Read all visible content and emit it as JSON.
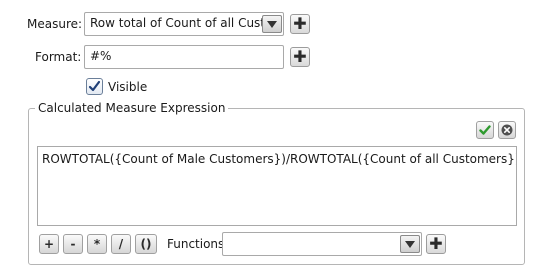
{
  "measure": {
    "label": "Measure:",
    "value": "Row total of Count of all Custo"
  },
  "format": {
    "label": "Format:",
    "value": "#%"
  },
  "visible": {
    "label": "Visible",
    "checked": true
  },
  "expression_group": {
    "title": "Calculated Measure Expression",
    "expression": "ROWTOTAL({Count of Male Customers})/ROWTOTAL({Count of all Customers})"
  },
  "operators": [
    "+",
    "-",
    "*",
    "/",
    "()"
  ],
  "functions": {
    "label": "Functions",
    "value": ""
  },
  "colors": {
    "accent_check": "#2e9a2e",
    "cancel": "#505050",
    "border": "#a9a9a9"
  }
}
